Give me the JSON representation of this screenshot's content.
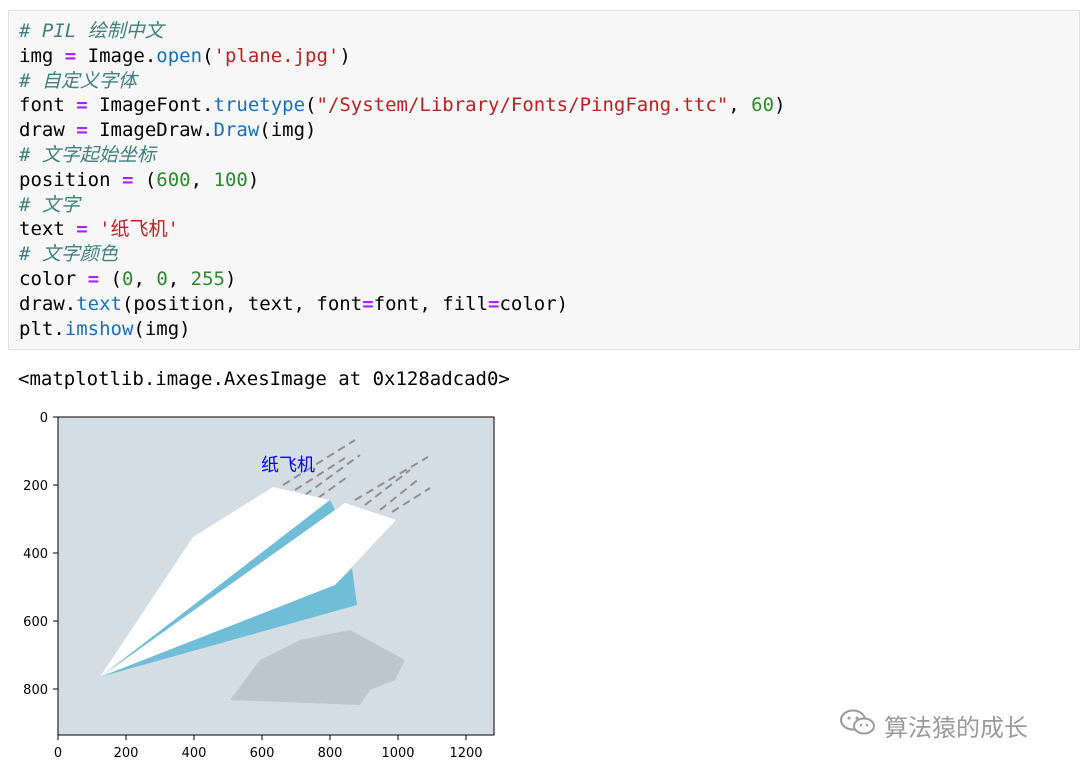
{
  "code_lines": [
    [
      {
        "t": "c",
        "v": "# PIL 绘制中文"
      }
    ],
    [
      {
        "t": "p",
        "v": "img "
      },
      {
        "t": "o",
        "v": "="
      },
      {
        "t": "p",
        "v": " Image."
      },
      {
        "t": "f",
        "v": "open"
      },
      {
        "t": "p",
        "v": "("
      },
      {
        "t": "s",
        "v": "'plane.jpg'"
      },
      {
        "t": "p",
        "v": ")"
      }
    ],
    [
      {
        "t": "c",
        "v": "# 自定义字体"
      }
    ],
    [
      {
        "t": "p",
        "v": "font "
      },
      {
        "t": "o",
        "v": "="
      },
      {
        "t": "p",
        "v": " ImageFont."
      },
      {
        "t": "f",
        "v": "truetype"
      },
      {
        "t": "p",
        "v": "("
      },
      {
        "t": "s",
        "v": "\"/System/Library/Fonts/PingFang.ttc\""
      },
      {
        "t": "p",
        "v": ", "
      },
      {
        "t": "n",
        "v": "60"
      },
      {
        "t": "p",
        "v": ")"
      }
    ],
    [
      {
        "t": "p",
        "v": "draw "
      },
      {
        "t": "o",
        "v": "="
      },
      {
        "t": "p",
        "v": " ImageDraw."
      },
      {
        "t": "f",
        "v": "Draw"
      },
      {
        "t": "p",
        "v": "(img)"
      }
    ],
    [
      {
        "t": "c",
        "v": "# 文字起始坐标"
      }
    ],
    [
      {
        "t": "p",
        "v": "position "
      },
      {
        "t": "o",
        "v": "="
      },
      {
        "t": "p",
        "v": " ("
      },
      {
        "t": "n",
        "v": "600"
      },
      {
        "t": "p",
        "v": ", "
      },
      {
        "t": "n",
        "v": "100"
      },
      {
        "t": "p",
        "v": ")"
      }
    ],
    [
      {
        "t": "c",
        "v": "# 文字"
      }
    ],
    [
      {
        "t": "p",
        "v": "text "
      },
      {
        "t": "o",
        "v": "="
      },
      {
        "t": "p",
        "v": " "
      },
      {
        "t": "s",
        "v": "'纸飞机'"
      }
    ],
    [
      {
        "t": "c",
        "v": "# 文字颜色"
      }
    ],
    [
      {
        "t": "p",
        "v": "color "
      },
      {
        "t": "o",
        "v": "="
      },
      {
        "t": "p",
        "v": " ("
      },
      {
        "t": "n",
        "v": "0"
      },
      {
        "t": "p",
        "v": ", "
      },
      {
        "t": "n",
        "v": "0"
      },
      {
        "t": "p",
        "v": ", "
      },
      {
        "t": "n",
        "v": "255"
      },
      {
        "t": "p",
        "v": ")"
      }
    ],
    [
      {
        "t": "p",
        "v": "draw."
      },
      {
        "t": "f",
        "v": "text"
      },
      {
        "t": "p",
        "v": "(position, text, font"
      },
      {
        "t": "o",
        "v": "="
      },
      {
        "t": "p",
        "v": "font, fill"
      },
      {
        "t": "o",
        "v": "="
      },
      {
        "t": "p",
        "v": "color)"
      }
    ],
    [
      {
        "t": "p",
        "v": "plt."
      },
      {
        "t": "f",
        "v": "imshow"
      },
      {
        "t": "p",
        "v": "(img)"
      }
    ]
  ],
  "output": {
    "text": "<matplotlib.image.AxesImage at 0x128adcad0>"
  },
  "plot": {
    "image_text": "纸飞机",
    "image_text_color": "#0000ff",
    "background_color": "#d4dde4",
    "plane_fill": "#ffffff",
    "plane_shade": "#6fbdd6",
    "x_ticks": [
      "0",
      "200",
      "400",
      "600",
      "800",
      "1000",
      "1200"
    ],
    "y_ticks": [
      "0",
      "200",
      "400",
      "600",
      "800"
    ]
  },
  "watermark": {
    "icon": "wechat-icon",
    "text": "算法猿的成长"
  },
  "colors": {
    "comment": "#408080",
    "operator": "#aa22ff",
    "function": "#1a6fbd",
    "string": "#ba2121",
    "number": "#2d8a2d"
  }
}
